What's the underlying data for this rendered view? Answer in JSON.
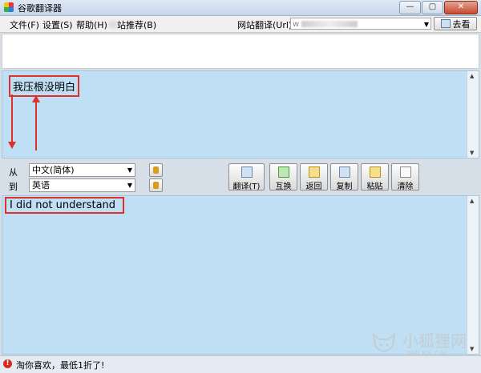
{
  "window": {
    "title": "谷歌翻译器",
    "min": "—",
    "max": "▢",
    "close": "✕"
  },
  "menu": {
    "file": "文件(F)",
    "settings": "设置(S)",
    "help": "帮助(H)",
    "recommend": "站推荐(B)",
    "site_translate": "网站翻译(Url)",
    "url_prefix": "w",
    "go_label": "去看"
  },
  "source": {
    "text": "我压根没明白"
  },
  "controls": {
    "from_label": "从",
    "to_label": "到",
    "from_lang": "中文(简体)",
    "to_lang": "英语",
    "buttons": {
      "translate": "翻译(T)",
      "swap": "互换",
      "back": "返回",
      "copy": "复制",
      "paste": "粘贴",
      "clear": "清除"
    }
  },
  "result": {
    "text": "I did not understand"
  },
  "status": {
    "text": "淘你喜欢，最低1折了!"
  },
  "watermark": {
    "cn": "小狐狸网",
    "en": "XHLKS.CN"
  },
  "colors": {
    "text_area_bg": "#bedff4",
    "highlight_red": "#e0302a"
  }
}
